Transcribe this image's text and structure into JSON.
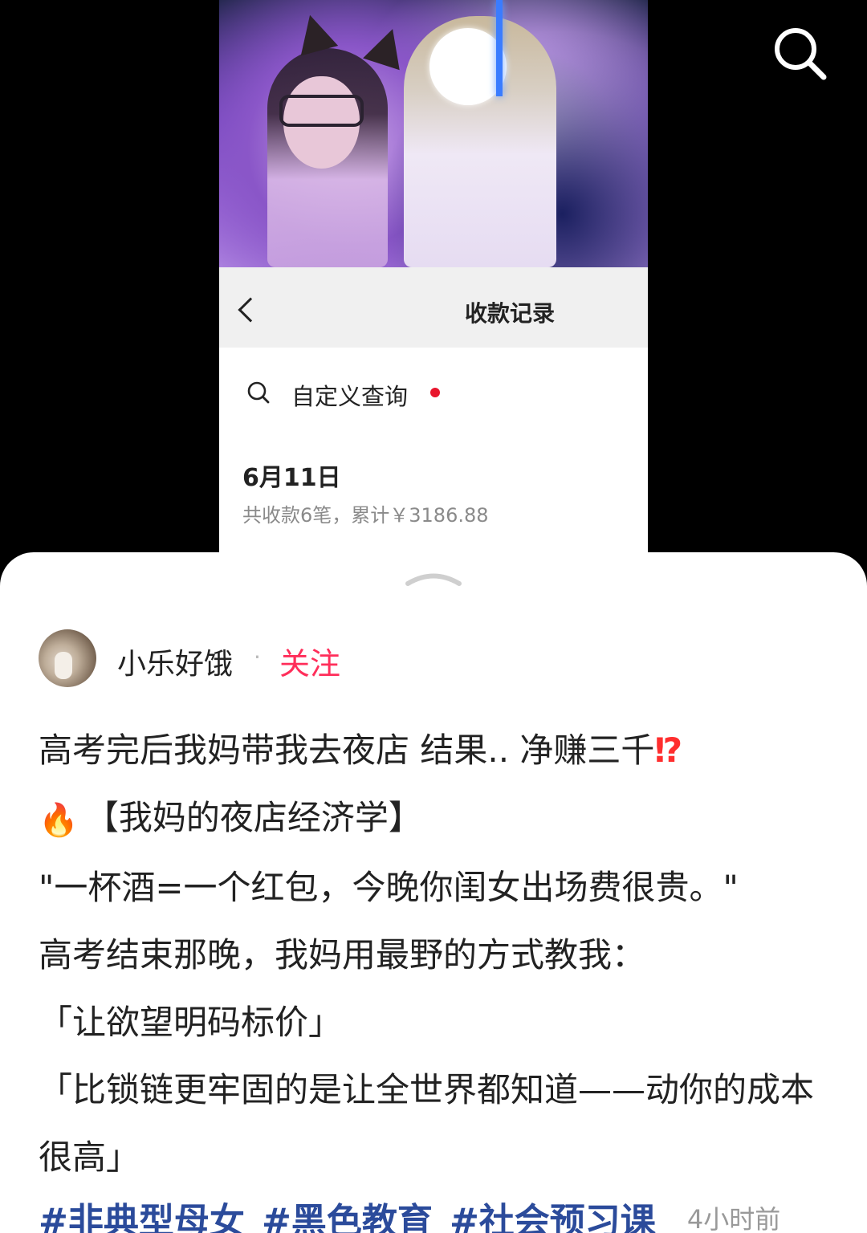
{
  "top_bar": {
    "search_icon": "search-icon"
  },
  "screenshot": {
    "nav_title": "收款记录",
    "back_icon": "chevron-left-icon",
    "query_label": "自定义查询",
    "date": "6月11日",
    "summary": "共收款6笔，累计￥3186.88"
  },
  "post": {
    "author": "小乐好饿",
    "separator": "·",
    "follow_label": "关注",
    "lines": [
      "高考完后我妈带我去夜店 结果.. 净赚三千",
      "【我妈的夜店经济学】",
      "\"一杯酒=一个红包，今晚你闺女出场费很贵。\"",
      "高考结束那晚，我妈用最野的方式教我：",
      "「让欲望明码标价」",
      "「比锁链更牢固的是让全世界都知道——动你的成本很高」"
    ],
    "exclaim_emoji": "⁉",
    "fire_emoji": "🔥",
    "tags": [
      "#非典型母女",
      "#黑色教育",
      "#社会预习课"
    ],
    "time_ago": "4小时前"
  },
  "colors": {
    "follow": "#ff2e5a",
    "tag": "#2b4b9b",
    "red_dot": "#e8162d"
  }
}
